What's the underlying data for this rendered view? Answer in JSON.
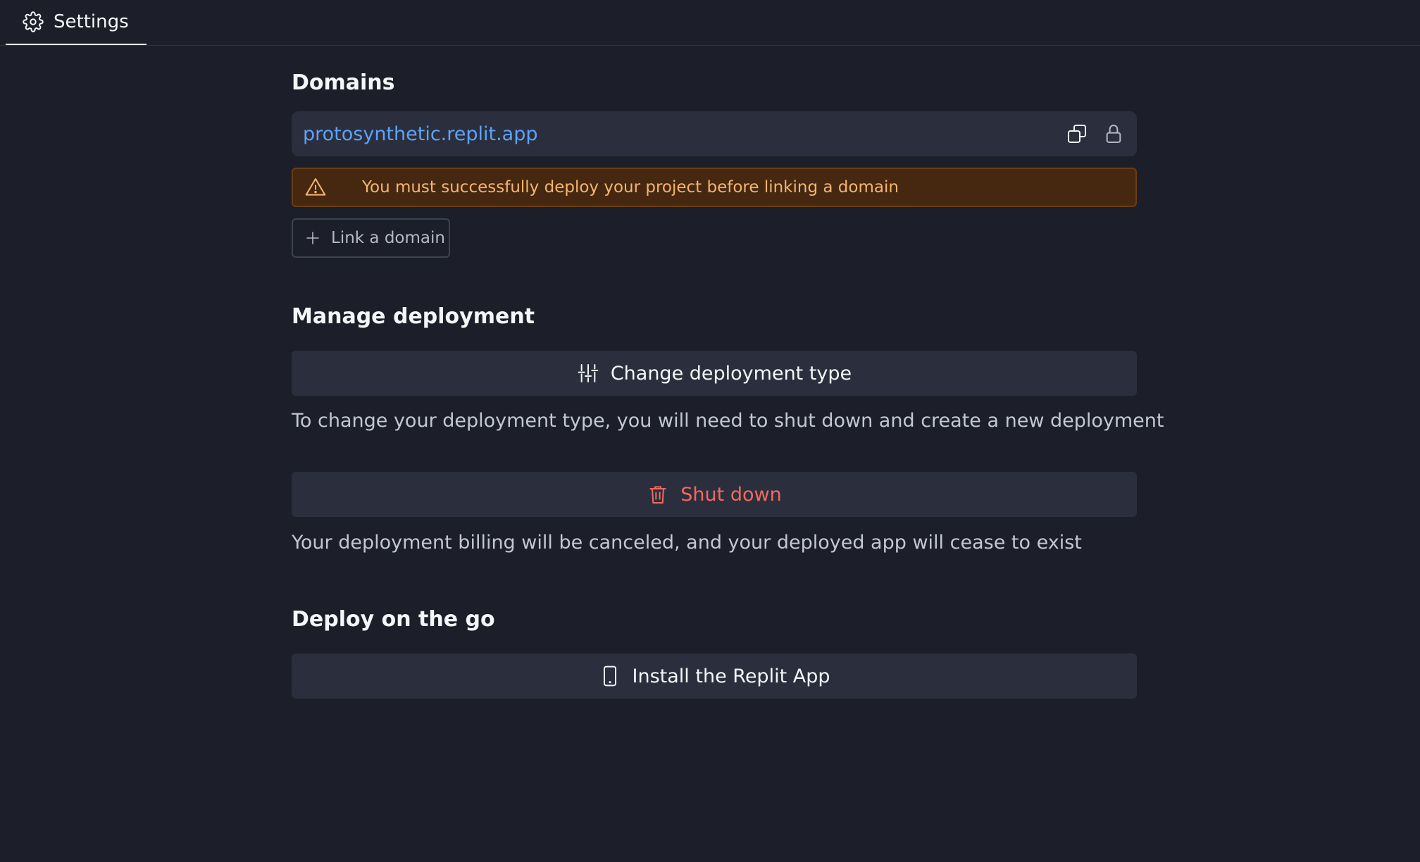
{
  "tab": {
    "label": "Settings",
    "icon": "gear-icon"
  },
  "domains": {
    "title": "Domains",
    "domain": "protosynthetic.replit.app",
    "warning": "You must successfully deploy your project before linking a domain",
    "link_label": "Link a domain"
  },
  "manage": {
    "title": "Manage deployment",
    "change_label": "Change deployment type",
    "change_help": "To change your deployment type, you will need to shut down and create a new deployment",
    "shutdown_label": "Shut down",
    "shutdown_help": "Your deployment billing will be canceled, and your deployed app will cease to exist"
  },
  "go": {
    "title": "Deploy on the go",
    "install_label": "Install the Replit App"
  },
  "colors": {
    "background": "#1c1f2a",
    "surface": "#2b2f3d",
    "link": "#5ea2f9",
    "warning_bg": "#462810",
    "warning_text": "#f7b46f",
    "danger": "#f0695f"
  }
}
